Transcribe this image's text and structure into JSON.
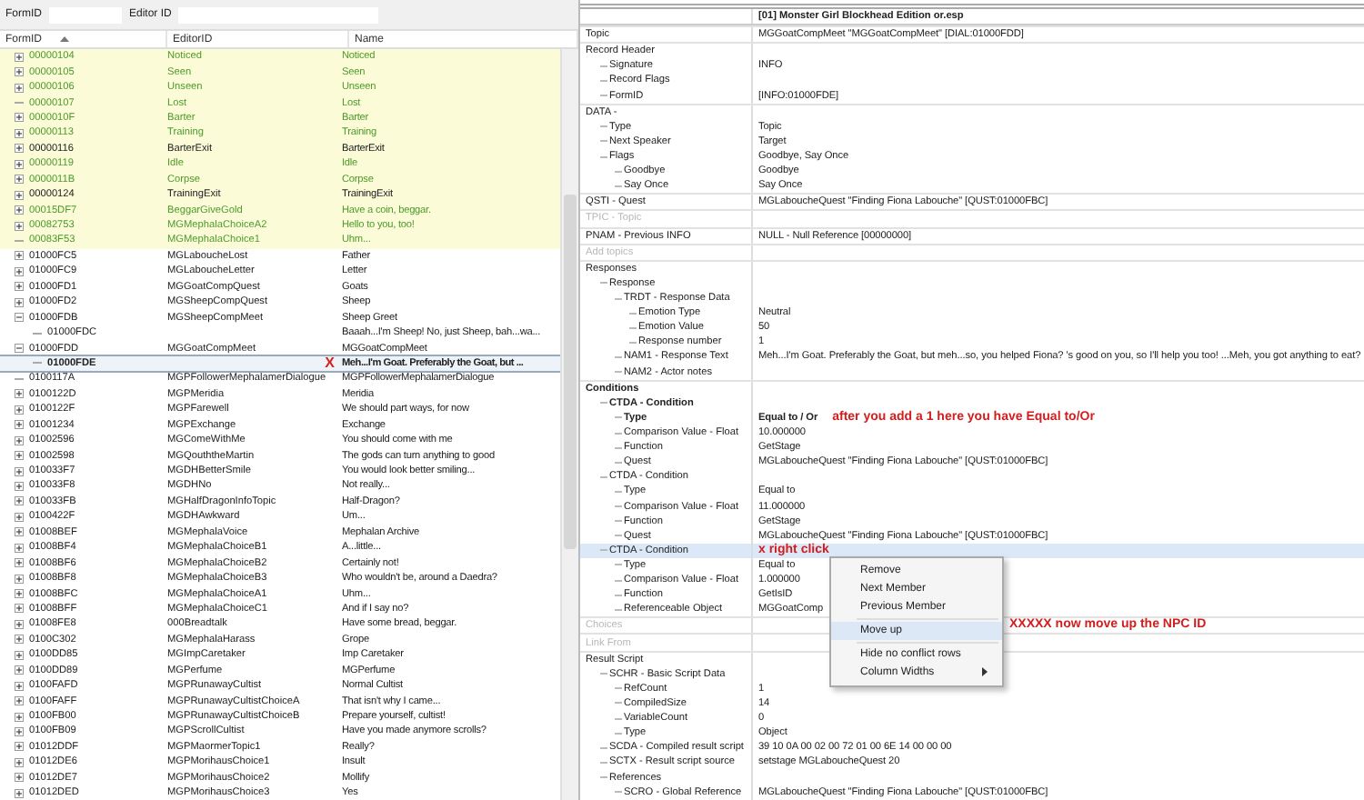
{
  "filter": {
    "formid_label": "FormID",
    "editorid_label": "Editor ID"
  },
  "columns": [
    "FormID",
    "EditorID",
    "Name"
  ],
  "rows": [
    {
      "id": "00000104",
      "editor_id": "Noticed",
      "name": "Noticed",
      "color": "#4f9a2c",
      "highlighted": true,
      "expanded": false,
      "selected": false
    },
    {
      "id": "00000105",
      "editor_id": "Seen",
      "name": "Seen",
      "color": "#4f9a2c",
      "highlighted": true,
      "expanded": false,
      "selected": false
    },
    {
      "id": "00000106",
      "editor_id": "Unseen",
      "name": "Unseen",
      "color": "#4f9a2c",
      "highlighted": true,
      "expanded": false,
      "selected": false
    },
    {
      "id": "00000107",
      "editor_id": "Lost",
      "name": "Lost",
      "color": "#4f9a2c",
      "highlighted": true,
      "selected": false
    },
    {
      "id": "0000010F",
      "editor_id": "Barter",
      "name": "Barter",
      "color": "#4f9a2c",
      "highlighted": true,
      "expanded": false,
      "selected": false
    },
    {
      "id": "00000113",
      "editor_id": "Training",
      "name": "Training",
      "color": "#4f9a2c",
      "highlighted": true,
      "expanded": false,
      "selected": false
    },
    {
      "id": "00000116",
      "editor_id": "BarterExit",
      "name": "BarterExit",
      "color": "#222222",
      "highlighted": true,
      "expanded": false,
      "selected": false
    },
    {
      "id": "00000119",
      "editor_id": "Idle",
      "name": "Idle",
      "color": "#4f9a2c",
      "highlighted": true,
      "expanded": false,
      "selected": false
    },
    {
      "id": "0000011B",
      "editor_id": "Corpse",
      "name": "Corpse",
      "color": "#4f9a2c",
      "highlighted": true,
      "expanded": false,
      "selected": false
    },
    {
      "id": "00000124",
      "editor_id": "TrainingExit",
      "name": "TrainingExit",
      "color": "#222222",
      "highlighted": true,
      "expanded": false,
      "selected": false
    },
    {
      "id": "00015DF7",
      "editor_id": "BeggarGiveGold",
      "name": "Have a coin, beggar.",
      "color": "#4f9a2c",
      "highlighted": true,
      "expanded": false,
      "selected": false
    },
    {
      "id": "00082753",
      "editor_id": "MGMephalaChoiceA2",
      "name": "Hello to you, too!",
      "color": "#4f9a2c",
      "highlighted": true,
      "expanded": false,
      "selected": false
    },
    {
      "id": "00083F53",
      "editor_id": "MGMephalaChoice1",
      "name": "Uhm...",
      "color": "#4f9a2c",
      "highlighted": true,
      "selected": false
    },
    {
      "id": "01000FC5",
      "editor_id": "MGLaboucheLost",
      "name": "Father",
      "color": "#222222",
      "highlighted": false,
      "expanded": false,
      "selected": false
    },
    {
      "id": "01000FC9",
      "editor_id": "MGLaboucheLetter",
      "name": "Letter",
      "color": "#222222",
      "highlighted": false,
      "expanded": false,
      "selected": false
    },
    {
      "id": "01000FD1",
      "editor_id": "MGGoatCompQuest",
      "name": "Goats",
      "color": "#222222",
      "highlighted": false,
      "expanded": false,
      "selected": false
    },
    {
      "id": "01000FD2",
      "editor_id": "MGSheepCompQuest",
      "name": "Sheep",
      "color": "#222222",
      "highlighted": false,
      "expanded": false,
      "selected": false
    },
    {
      "id": "01000FDB",
      "editor_id": "MGSheepCompMeet",
      "name": "Sheep Greet",
      "color": "#222222",
      "highlighted": false,
      "expanded": true,
      "selected": false,
      "children": [
        {
          "id": "01000FDC",
          "name": "Baaah...I'm Sheep! No, just Sheep, bah...wa...",
          "color": "#222222",
          "highlighted": false,
          "selected": false
        }
      ]
    },
    {
      "id": "01000FDD",
      "editor_id": "MGGoatCompMeet",
      "name": "MGGoatCompMeet",
      "color": "#222222",
      "highlighted": false,
      "expanded": true,
      "selected": false,
      "children": [
        {
          "id": "01000FDE",
          "name": "Meh...I'm Goat. Preferably the Goat, but ...",
          "color": "#222222",
          "highlighted": false,
          "selected": true,
          "note": "X"
        }
      ]
    },
    {
      "id": "0100117A",
      "editor_id": "MGPFollowerMephalamerDialogue",
      "name": "MGPFollowerMephalamerDialogue",
      "color": "#222222",
      "highlighted": false,
      "selected": false
    },
    {
      "id": "0100122D",
      "editor_id": "MGPMeridia",
      "name": "Meridia",
      "color": "#222222",
      "highlighted": false,
      "expanded": false,
      "selected": false
    },
    {
      "id": "0100122F",
      "editor_id": "MGPFarewell",
      "name": "We should part ways, for now",
      "color": "#222222",
      "highlighted": false,
      "expanded": false,
      "selected": false
    },
    {
      "id": "01001234",
      "editor_id": "MGPExchange",
      "name": "Exchange",
      "color": "#222222",
      "highlighted": false,
      "expanded": false,
      "selected": false
    },
    {
      "id": "01002596",
      "editor_id": "MGComeWithMe",
      "name": "You should come with me",
      "color": "#222222",
      "highlighted": false,
      "expanded": false,
      "selected": false
    },
    {
      "id": "01002598",
      "editor_id": "MGQouththeMartin",
      "name": "The gods can turn anything to good",
      "color": "#222222",
      "highlighted": false,
      "expanded": false,
      "selected": false
    },
    {
      "id": "010033F7",
      "editor_id": "MGDHBetterSmile",
      "name": "You would look better smiling...",
      "color": "#222222",
      "highlighted": false,
      "expanded": false,
      "selected": false
    },
    {
      "id": "010033F8",
      "editor_id": "MGDHNo",
      "name": "Not really...",
      "color": "#222222",
      "highlighted": false,
      "expanded": false,
      "selected": false
    },
    {
      "id": "010033FB",
      "editor_id": "MGHalfDragonInfoTopic",
      "name": "Half-Dragon?",
      "color": "#222222",
      "highlighted": false,
      "expanded": false,
      "selected": false
    },
    {
      "id": "0100422F",
      "editor_id": "MGDHAwkward",
      "name": "Um...",
      "color": "#222222",
      "highlighted": false,
      "expanded": false,
      "selected": false
    },
    {
      "id": "01008BEF",
      "editor_id": "MGMephalaVoice",
      "name": "Mephalan Archive",
      "color": "#222222",
      "highlighted": false,
      "expanded": false,
      "selected": false
    },
    {
      "id": "01008BF4",
      "editor_id": "MGMephalaChoiceB1",
      "name": "A...little...",
      "color": "#222222",
      "highlighted": false,
      "expanded": false,
      "selected": false
    },
    {
      "id": "01008BF6",
      "editor_id": "MGMephalaChoiceB2",
      "name": "Certainly not!",
      "color": "#222222",
      "highlighted": false,
      "expanded": false,
      "selected": false
    },
    {
      "id": "01008BF8",
      "editor_id": "MGMephalaChoiceB3",
      "name": "Who wouldn't be, around a Daedra?",
      "color": "#222222",
      "highlighted": false,
      "expanded": false,
      "selected": false
    },
    {
      "id": "01008BFC",
      "editor_id": "MGMephalaChoiceA1",
      "name": "Uhm...",
      "color": "#222222",
      "highlighted": false,
      "expanded": false,
      "selected": false
    },
    {
      "id": "01008BFF",
      "editor_id": "MGMephalaChoiceC1",
      "name": "And if I say no?",
      "color": "#222222",
      "highlighted": false,
      "expanded": false,
      "selected": false
    },
    {
      "id": "01008FE8",
      "editor_id": "000Breadtalk",
      "name": "Have some bread, beggar.",
      "color": "#222222",
      "highlighted": false,
      "expanded": false,
      "selected": false
    },
    {
      "id": "0100C302",
      "editor_id": "MGMephalaHarass",
      "name": "Grope",
      "color": "#222222",
      "highlighted": false,
      "expanded": false,
      "selected": false
    },
    {
      "id": "0100DD85",
      "editor_id": "MGImpCaretaker",
      "name": "Imp Caretaker",
      "color": "#222222",
      "highlighted": false,
      "expanded": false,
      "selected": false
    },
    {
      "id": "0100DD89",
      "editor_id": "MGPerfume",
      "name": "MGPerfume",
      "color": "#222222",
      "highlighted": false,
      "expanded": false,
      "selected": false
    },
    {
      "id": "0100FAFD",
      "editor_id": "MGPRunawayCultist",
      "name": "Normal Cultist",
      "color": "#222222",
      "highlighted": false,
      "expanded": false,
      "selected": false
    },
    {
      "id": "0100FAFF",
      "editor_id": "MGPRunawayCultistChoiceA",
      "name": "That isn't why I came...",
      "color": "#222222",
      "highlighted": false,
      "expanded": false,
      "selected": false
    },
    {
      "id": "0100FB00",
      "editor_id": "MGPRunawayCultistChoiceB",
      "name": "Prepare yourself, cultist!",
      "color": "#222222",
      "highlighted": false,
      "expanded": false,
      "selected": false
    },
    {
      "id": "0100FB09",
      "editor_id": "MGPScrollCultist",
      "name": "Have you made anymore scrolls?",
      "color": "#222222",
      "highlighted": false,
      "expanded": false,
      "selected": false
    },
    {
      "id": "01012DDF",
      "editor_id": "MGPMaormerTopic1",
      "name": "Really?",
      "color": "#222222",
      "highlighted": false,
      "expanded": false,
      "selected": false
    },
    {
      "id": "01012DE6",
      "editor_id": "MGPMorihausChoice1",
      "name": "Insult",
      "color": "#222222",
      "highlighted": false,
      "expanded": false,
      "selected": false
    },
    {
      "id": "01012DE7",
      "editor_id": "MGPMorihausChoice2",
      "name": "Mollify",
      "color": "#222222",
      "highlighted": false,
      "expanded": false,
      "selected": false
    },
    {
      "id": "01012DED",
      "editor_id": "MGPMorihausChoice3",
      "name": "Yes",
      "color": "#222222",
      "highlighted": false,
      "expanded": false,
      "selected": false
    }
  ],
  "record_title": "[01] Monster Girl Blockhead Edition or.esp",
  "fields": [
    {
      "label": "Topic",
      "value": "MGGoatCompMeet \"MGGoatCompMeet\" [DIAL:01000FDD]",
      "selected": false
    },
    {
      "label": "Record Header",
      "selected": false,
      "children": [
        {
          "label": "Signature",
          "value": "INFO",
          "selected": false
        },
        {
          "label": "Record Flags",
          "selected": false
        },
        {
          "label": "FormID",
          "value": "[INFO:01000FDE]",
          "selected": false
        }
      ]
    },
    {
      "label": "DATA -",
      "selected": false,
      "children": [
        {
          "label": "Type",
          "value": "Topic",
          "selected": false
        },
        {
          "label": "Next Speaker",
          "value": "Target",
          "selected": false
        },
        {
          "label": "Flags",
          "value": "Goodbye, Say Once",
          "selected": false,
          "children": [
            {
              "label": "Goodbye",
              "value": "Goodbye",
              "selected": false
            },
            {
              "label": "Say Once",
              "value": "Say Once",
              "selected": false
            }
          ]
        }
      ]
    },
    {
      "label": "QSTI - Quest",
      "value": "MGLaboucheQuest \"Finding Fiona Labouche\" [QUST:01000FBC]",
      "selected": false
    },
    {
      "label": "TPIC - Topic",
      "disabled": true,
      "selected": false
    },
    {
      "label": "PNAM - Previous INFO",
      "value": "NULL - Null Reference [00000000]",
      "selected": false
    },
    {
      "label": "Add topics",
      "disabled": true,
      "selected": false
    },
    {
      "label": "Responses",
      "selected": false,
      "children": [
        {
          "label": "Response",
          "selected": false,
          "children": [
            {
              "label": "TRDT - Response Data",
              "selected": false,
              "children": [
                {
                  "label": "Emotion Type",
                  "value": "Neutral",
                  "selected": false
                },
                {
                  "label": "Emotion Value",
                  "value": "50",
                  "selected": false
                },
                {
                  "label": "Response number",
                  "value": "1",
                  "selected": false
                }
              ]
            },
            {
              "label": "NAM1 - Response Text",
              "value": "Meh...I'm Goat. Preferably the Goat, but meh...so, you helped Fiona? 's good on you, so I'll help you too! ...Meh, you got anything to eat?",
              "selected": false
            },
            {
              "label": "NAM2 - Actor notes",
              "selected": false
            }
          ]
        }
      ]
    },
    {
      "label": "Conditions",
      "bold": true,
      "selected": false,
      "children": [
        {
          "label": "CTDA - Condition",
          "bold": true,
          "selected": false,
          "children": [
            {
              "label": "Type",
              "value": "Equal to / Or",
              "bold": true,
              "selected": false,
              "note": "after you add a 1 here you have Equal to/Or"
            },
            {
              "label": "Comparison Value - Float",
              "value": "10.000000",
              "selected": false
            },
            {
              "label": "Function",
              "value": "GetStage",
              "selected": false
            },
            {
              "label": "Quest",
              "value": "MGLaboucheQuest \"Finding Fiona Labouche\" [QUST:01000FBC]",
              "selected": false
            }
          ]
        },
        {
          "label": "CTDA - Condition",
          "selected": false,
          "children": [
            {
              "label": "Type",
              "value": "Equal to",
              "selected": false
            },
            {
              "label": "Comparison Value - Float",
              "value": "11.000000",
              "selected": false
            },
            {
              "label": "Function",
              "value": "GetStage",
              "selected": false
            },
            {
              "label": "Quest",
              "value": "MGLaboucheQuest \"Finding Fiona Labouche\" [QUST:01000FBC]",
              "selected": false
            }
          ]
        },
        {
          "label": "CTDA - Condition",
          "selected": true,
          "note": "x right click",
          "children": [
            {
              "label": "Type",
              "value": "Equal to",
              "selected": false
            },
            {
              "label": "Comparison Value - Float",
              "value": "1.000000",
              "selected": false
            },
            {
              "label": "Function",
              "value": "GetIsID",
              "selected": false
            },
            {
              "label": "Referenceable Object",
              "value": "MGGoatComp",
              "selected": false
            }
          ]
        }
      ]
    },
    {
      "label": "Choices",
      "disabled": true,
      "selected": false
    },
    {
      "label": "Link From",
      "disabled": true,
      "selected": false
    },
    {
      "label": "Result Script",
      "selected": false,
      "children": [
        {
          "label": "SCHR - Basic Script Data",
          "selected": false,
          "children": [
            {
              "label": "RefCount",
              "value": "1",
              "selected": false
            },
            {
              "label": "CompiledSize",
              "value": "14",
              "selected": false
            },
            {
              "label": "VariableCount",
              "value": "0",
              "selected": false
            },
            {
              "label": "Type",
              "value": "Object",
              "selected": false
            }
          ]
        },
        {
          "label": "SCDA - Compiled result script",
          "value": "39 10 0A 00 02 00 72 01 00 6E 14 00 00 00",
          "selected": false
        },
        {
          "label": "SCTX - Result script source",
          "value": "setstage MGLaboucheQuest 20",
          "selected": false
        },
        {
          "label": "References",
          "selected": false,
          "children": [
            {
              "label": "SCRO - Global Reference",
              "value": "MGLaboucheQuest \"Finding Fiona Labouche\" [QUST:01000FBC]",
              "selected": false
            }
          ]
        }
      ]
    }
  ],
  "context_menu": [
    {
      "kind": "item",
      "label": "Remove",
      "selected": false
    },
    {
      "kind": "item",
      "label": "Next Member",
      "selected": false
    },
    {
      "kind": "item",
      "label": "Previous Member",
      "selected": false
    },
    {
      "kind": "separator"
    },
    {
      "kind": "item",
      "label": "Move up",
      "selected": true,
      "note": "XXXXX  now move up the NPC ID"
    },
    {
      "kind": "separator"
    },
    {
      "kind": "item",
      "label": "Hide no conflict rows",
      "selected": false
    },
    {
      "kind": "submenu",
      "label": "Column Widths",
      "selected": false
    }
  ]
}
